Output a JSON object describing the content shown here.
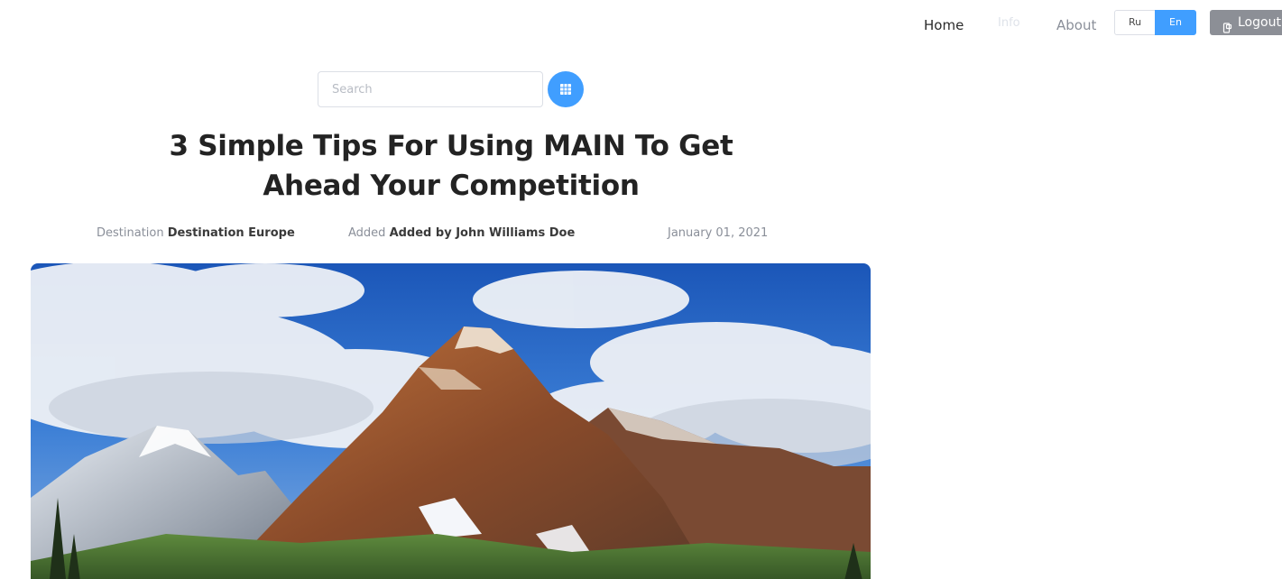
{
  "nav": {
    "home": "Home",
    "info": "Info",
    "about": "About",
    "lang_ru": "Ru",
    "lang_en": "En",
    "active_lang": "En",
    "logout": "Logout"
  },
  "search": {
    "placeholder": "Search",
    "button_icon": "grid-icon"
  },
  "article": {
    "title_line1": "3 Simple Tips For Using MAIN To Get",
    "title_line2": "Ahead Your Competition",
    "destination_label": "Destination",
    "destination_value": "Destination Europe",
    "added_label": "Added",
    "added_value": "Added by John Williams Doe",
    "date": "January 01, 2021",
    "image": "mountain-landscape-photo"
  },
  "colors": {
    "accent": "#409eff",
    "logout_bg": "#8c8f96",
    "title": "#232323",
    "muted": "#8a8f99"
  }
}
